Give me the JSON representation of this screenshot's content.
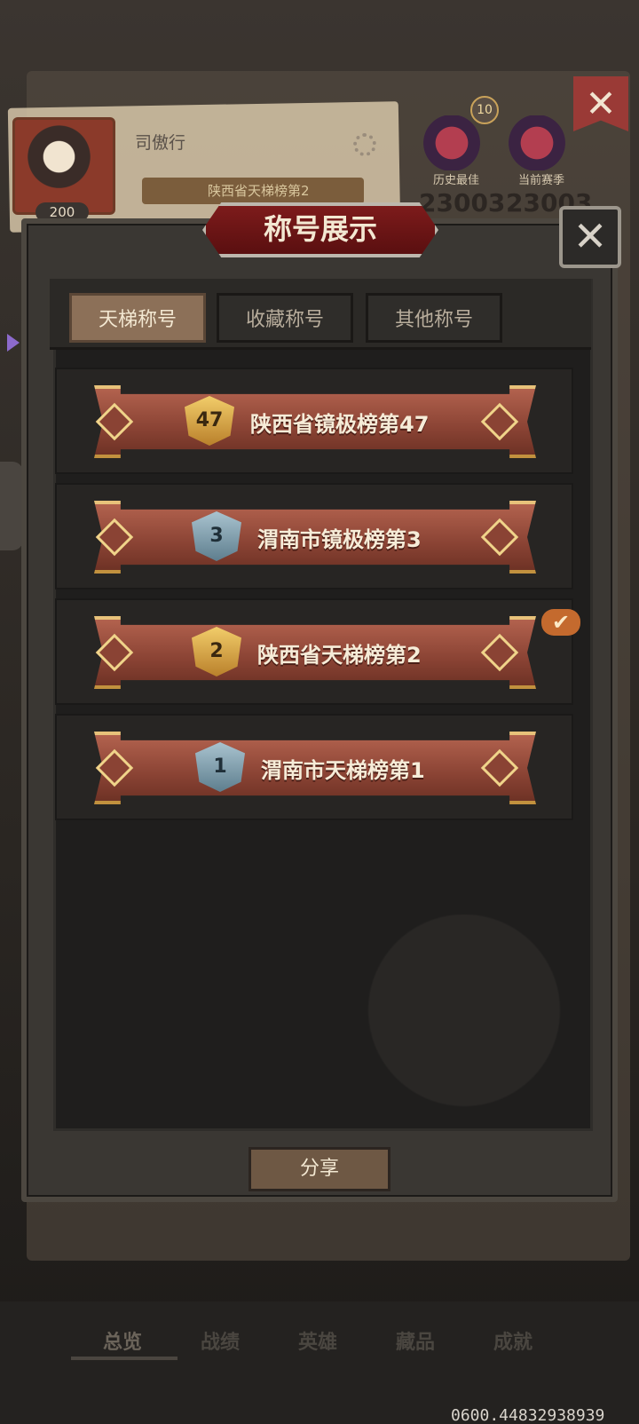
{
  "profile": {
    "name": "司傲行",
    "level": "200",
    "title": "陕西省天梯榜第2",
    "title_rank": "2",
    "best_label": "历史最佳",
    "current_label": "当前赛季",
    "best_score": "23003",
    "current_score": "23003",
    "season_rank": "10"
  },
  "modal": {
    "title": "称号展示",
    "close_symbol": "✕",
    "tabs": [
      {
        "label": "天梯称号",
        "active": true
      },
      {
        "label": "收藏称号",
        "active": false
      },
      {
        "label": "其他称号",
        "active": false
      }
    ],
    "titles": [
      {
        "rank": "47",
        "text": "陕西省镜极榜第47",
        "badge": "gold",
        "equipped": false
      },
      {
        "rank": "3",
        "text": "渭南市镜极榜第3",
        "badge": "silver",
        "equipped": false
      },
      {
        "rank": "2",
        "text": "陕西省天梯榜第2",
        "badge": "gold",
        "equipped": true
      },
      {
        "rank": "1",
        "text": "渭南市天梯榜第1",
        "badge": "silver",
        "equipped": false
      }
    ],
    "equipped_symbol": "✔",
    "share_label": "分享"
  },
  "top_close_symbol": "✕",
  "bottom_nav": [
    {
      "label": "总览",
      "active": true
    },
    {
      "label": "战绩",
      "active": false
    },
    {
      "label": "英雄",
      "active": false
    },
    {
      "label": "藏品",
      "active": false
    },
    {
      "label": "成就",
      "active": false
    }
  ],
  "debug_number": "0600.44832938939",
  "colors": {
    "title_red": "#7d1b1b",
    "banner": "#8a4334",
    "gold": "#f2cd6a",
    "silver": "#a9c3cf",
    "check": "#c46a2e"
  }
}
